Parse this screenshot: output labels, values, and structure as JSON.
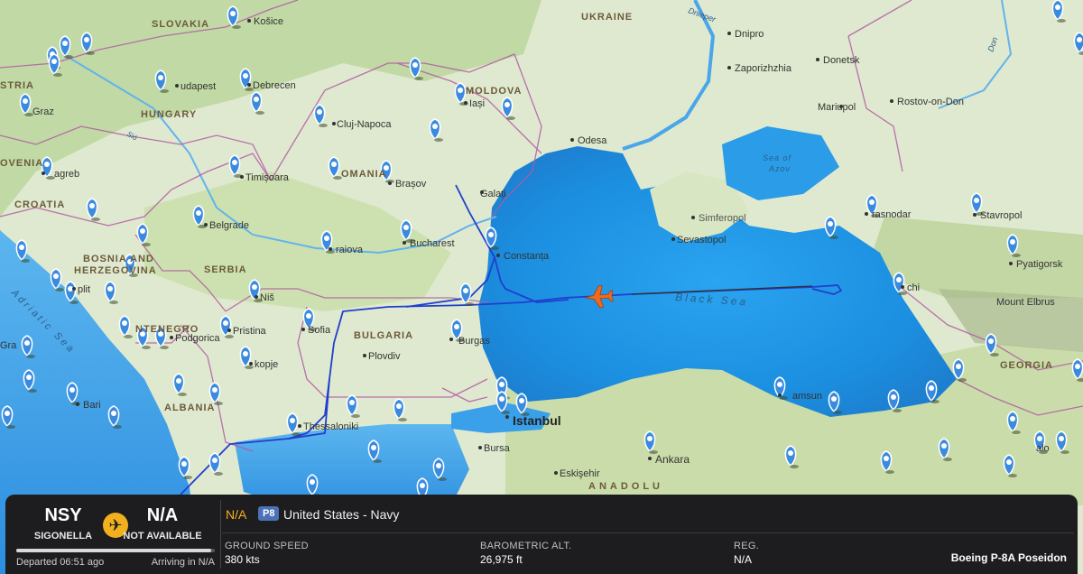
{
  "map": {
    "countries": [
      {
        "id": "slovakia",
        "name": "SLOVAKIA"
      },
      {
        "id": "ukraine",
        "name": "UKRAINE"
      },
      {
        "id": "moldova",
        "name": "MOLDOVA"
      },
      {
        "id": "hungary",
        "name": "HUNGARY"
      },
      {
        "id": "austria",
        "name": "STRIA"
      },
      {
        "id": "slovenia",
        "name": "OVENIA"
      },
      {
        "id": "croatia",
        "name": "CROATIA"
      },
      {
        "id": "romania",
        "name": "OMANIA"
      },
      {
        "id": "bosnia1",
        "name": "BOSNIA AND"
      },
      {
        "id": "bosnia2",
        "name": "HERZEGOVINA"
      },
      {
        "id": "serbia",
        "name": "SERBIA"
      },
      {
        "id": "montenegro",
        "name": "NTENEGRO"
      },
      {
        "id": "bulgaria",
        "name": "BULGARIA"
      },
      {
        "id": "albania",
        "name": "ALBANIA"
      },
      {
        "id": "georgia",
        "name": "GEORGIA"
      },
      {
        "id": "anadolu",
        "name": "ANADOLU"
      }
    ],
    "cities": [
      {
        "id": "kosice",
        "name": "Košice"
      },
      {
        "id": "dnipro",
        "name": "Dnipro"
      },
      {
        "id": "zaporizhzhia",
        "name": "Zaporizhzhia"
      },
      {
        "id": "donetsk",
        "name": "Donetsk"
      },
      {
        "id": "budapest",
        "name": "udapest"
      },
      {
        "id": "debrecen",
        "name": "Debrecen"
      },
      {
        "id": "iasi",
        "name": "Iași"
      },
      {
        "id": "graz",
        "name": "Graz"
      },
      {
        "id": "mariupol",
        "name": "Mariupol"
      },
      {
        "id": "rostov",
        "name": "Rostov-on-Don"
      },
      {
        "id": "cluj",
        "name": "Cluj-Napoca"
      },
      {
        "id": "odesa",
        "name": "Odesa"
      },
      {
        "id": "zagreb",
        "name": "agreb"
      },
      {
        "id": "timisoara",
        "name": "Timișoara"
      },
      {
        "id": "brasov",
        "name": "Brașov"
      },
      {
        "id": "galati",
        "name": "Galați"
      },
      {
        "id": "krasnodar",
        "name": "rasnodar"
      },
      {
        "id": "stavropol",
        "name": "Stavropol"
      },
      {
        "id": "simferopol",
        "name": "Simferopol"
      },
      {
        "id": "belgrade",
        "name": "Belgrade"
      },
      {
        "id": "sevastopol",
        "name": "Sevastopol"
      },
      {
        "id": "bucharest",
        "name": "Bucharest"
      },
      {
        "id": "craiova",
        "name": "raiova"
      },
      {
        "id": "constanta",
        "name": "Constanța"
      },
      {
        "id": "pyatigorsk",
        "name": "Pyatigorsk"
      },
      {
        "id": "sochi",
        "name": "chi"
      },
      {
        "id": "split",
        "name": "plit"
      },
      {
        "id": "nis",
        "name": "Niš"
      },
      {
        "id": "elbrus",
        "name": "Mount Elbrus"
      },
      {
        "id": "sofia",
        "name": "Sofia"
      },
      {
        "id": "pristina",
        "name": "Pristina"
      },
      {
        "id": "podgorica",
        "name": "Podgorica"
      },
      {
        "id": "burgas",
        "name": "Burgas"
      },
      {
        "id": "plovdiv",
        "name": "Plovdiv"
      },
      {
        "id": "skopje",
        "name": "kopje"
      },
      {
        "id": "samsun",
        "name": "amsun"
      },
      {
        "id": "bari",
        "name": "Bari"
      },
      {
        "id": "istanbul",
        "name": "Istanbul"
      },
      {
        "id": "thessaloniki",
        "name": "Thessaloniki"
      },
      {
        "id": "bursa",
        "name": "Bursa"
      },
      {
        "id": "ankara",
        "name": "Ankara"
      },
      {
        "id": "eskisehir",
        "name": "Eskişehir"
      },
      {
        "id": "gra",
        "name": "Gra"
      },
      {
        "id": "alo",
        "name": "alo"
      }
    ],
    "water": [
      {
        "id": "black-sea",
        "name": "Black Sea"
      },
      {
        "id": "azov1",
        "name": "Sea of"
      },
      {
        "id": "azov2",
        "name": "Azov"
      },
      {
        "id": "adriatic",
        "name": "Adriatic Sea"
      },
      {
        "id": "dnieper",
        "name": "Dnieper"
      },
      {
        "id": "don",
        "name": "Don"
      },
      {
        "id": "sio",
        "name": "Sió"
      }
    ]
  },
  "flight": {
    "origin_code": "NSY",
    "origin_name": "SIGONELLA",
    "dest_code": "N/A",
    "dest_name": "NOT AVAILABLE",
    "departed": "Departed 06:51 ago",
    "arriving": "Arriving in N/A",
    "progress_fraction": 0.98,
    "callsign": "N/A",
    "type_code": "P8",
    "operator": "United States - Navy",
    "ground_speed_label": "GROUND SPEED",
    "ground_speed": "380 kts",
    "baro_alt_label": "BAROMETRIC ALT.",
    "baro_alt": "26,975 ft",
    "reg_label": "REG.",
    "reg": "N/A",
    "aircraft_model": "Boeing P-8A Poseidon"
  },
  "colors": {
    "track": "#1f3fcf",
    "aircraft": "#ef6a1e",
    "accent": "#f2b01e",
    "badge": "#4b72b8",
    "sea": "#1c8fe0",
    "land": "#dfe9cf",
    "pin": "#3a8be0"
  },
  "icons": {
    "airport": "airport-pin-icon",
    "plane": "airplane-icon",
    "aircraft": "aircraft-marker-icon"
  }
}
